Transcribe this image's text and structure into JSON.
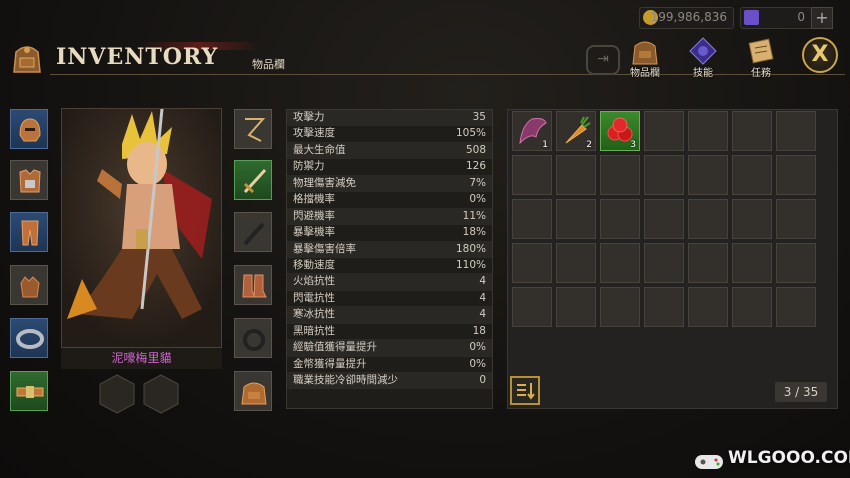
{
  "currency": {
    "gold": {
      "value": "199,986,836",
      "icon": "gold-coin-icon",
      "color": "#c79a2a"
    },
    "gems": {
      "value": "0",
      "icon": "purple-gem-icon",
      "color": "#6b4fc9"
    },
    "add_label": "+"
  },
  "header": {
    "title": "INVENTORY",
    "subtitle": "物品欄"
  },
  "top_menu": [
    {
      "label": "物品欄",
      "icon": "backpack-icon"
    },
    {
      "label": "技能",
      "icon": "skill-rune-icon"
    },
    {
      "label": "任務",
      "icon": "quest-scroll-icon"
    }
  ],
  "close_label": "X",
  "character": {
    "name": "泥嚎梅里貓"
  },
  "equipment_left": [
    {
      "name": "helmet-icon",
      "style": "blue"
    },
    {
      "name": "chest-armor-icon",
      "style": "gray"
    },
    {
      "name": "leg-armor-icon",
      "style": "blue"
    },
    {
      "name": "gloves-icon",
      "style": "gray"
    },
    {
      "name": "bracelet-icon",
      "style": "blue"
    },
    {
      "name": "belt-icon",
      "style": "green"
    }
  ],
  "equipment_right": [
    {
      "name": "necklace-icon",
      "style": "gray"
    },
    {
      "name": "sword-icon",
      "style": "green"
    },
    {
      "name": "dagger-silhouette-icon",
      "style": "gray"
    },
    {
      "name": "boots-icon",
      "style": "gray"
    },
    {
      "name": "ring-silhouette-icon",
      "style": "gray"
    },
    {
      "name": "backpack-slot-icon",
      "style": "gray"
    }
  ],
  "stats": [
    {
      "label": "攻擊力",
      "value": "35"
    },
    {
      "label": "攻擊速度",
      "value": "105%"
    },
    {
      "label": "最大生命值",
      "value": "508"
    },
    {
      "label": "防禦力",
      "value": "126"
    },
    {
      "label": "物理傷害減免",
      "value": "7%"
    },
    {
      "label": "格擋機率",
      "value": "0%"
    },
    {
      "label": "閃避機率",
      "value": "11%"
    },
    {
      "label": "暴擊機率",
      "value": "18%"
    },
    {
      "label": "暴擊傷害倍率",
      "value": "180%"
    },
    {
      "label": "移動速度",
      "value": "110%"
    },
    {
      "label": "火焰抗性",
      "value": "4"
    },
    {
      "label": "閃電抗性",
      "value": "4"
    },
    {
      "label": "寒冰抗性",
      "value": "4"
    },
    {
      "label": "黑暗抗性",
      "value": "18"
    },
    {
      "label": "經驗值獲得量提升",
      "value": "0%"
    },
    {
      "label": "金幣獲得量提升",
      "value": "0%"
    },
    {
      "label": "職業技能冷卻時間減少",
      "value": "0"
    }
  ],
  "inventory": {
    "items": [
      {
        "icon": "bat-wing-icon",
        "count": "1",
        "style": "normal"
      },
      {
        "icon": "carrot-icon",
        "count": "2",
        "style": "normal"
      },
      {
        "icon": "red-berries-icon",
        "count": "3",
        "style": "green"
      }
    ],
    "capacity": "3 / 35"
  },
  "watermark": "WLGOOO.COM"
}
